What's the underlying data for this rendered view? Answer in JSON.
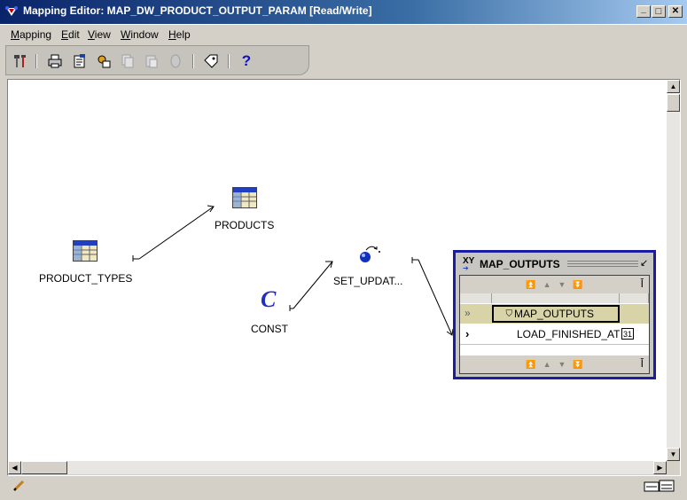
{
  "window": {
    "title": "Mapping Editor: MAP_DW_PRODUCT_OUTPUT_PARAM [Read/Write]",
    "minimize": "_",
    "maximize": "□",
    "close": "✕"
  },
  "menu": {
    "items": [
      {
        "label": "Mapping",
        "mnemonic": "M",
        "rest": "apping"
      },
      {
        "label": "Edit",
        "mnemonic": "E",
        "rest": "dit"
      },
      {
        "label": "View",
        "mnemonic": "V",
        "rest": "iew"
      },
      {
        "label": "Window",
        "mnemonic": "W",
        "rest": "indow"
      },
      {
        "label": "Help",
        "mnemonic": "H",
        "rest": "elp"
      }
    ]
  },
  "toolbar": {
    "icons": [
      "tools-icon",
      "print-icon",
      "properties-icon",
      "configure-icon",
      "copy-icon",
      "paste-icon",
      "object-icon",
      "tag-icon",
      "help-icon"
    ],
    "help_label": "?"
  },
  "canvas": {
    "nodes": {
      "products": "PRODUCTS",
      "product_types": "PRODUCT_TYPES",
      "const": "CONST",
      "const_symbol": "C",
      "set_update": "SET_UPDAT..."
    }
  },
  "map_outputs": {
    "title": "MAP_OUTPUTS",
    "title_icon": "XY",
    "group_label": "MAP_OUTPUTS",
    "field_label": "LOAD_FINISHED_AT",
    "field_type_icon": "31",
    "expand_glyph": "»",
    "row_arrow": "›"
  },
  "colors": {
    "titlebar_start": "#0a246a",
    "panel_border": "#1c1ca0",
    "group_row": "#d8d4a8",
    "window_bg": "#d4d0c8"
  }
}
